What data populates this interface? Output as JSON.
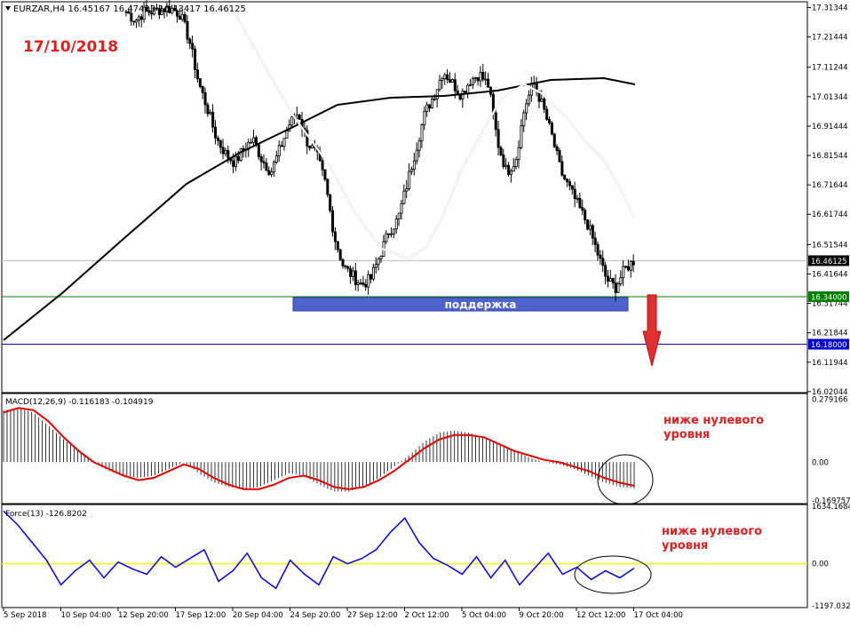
{
  "window": {
    "instrument_info": "EURZAR,H4  16.45167 16.47423 16.43417 16.46125",
    "date_stamp": "17/10/2018"
  },
  "colors": {
    "candles": "#000000",
    "ma_slow": "#000000",
    "ma_fast": "#ffffff",
    "support_line": "#008000",
    "target_line": "#0000cd",
    "support_zone": "#4f63cf",
    "arrow": "#e03030",
    "macd_signal": "#e00000",
    "force_line": "#0000e6",
    "force_zero": "#ffff00",
    "annotation_text": "#e02020",
    "ellipse": "#000000"
  },
  "chart_data": [
    {
      "type": "candlestick",
      "panel": "price",
      "title": "EURZAR,H4",
      "ohlc_header": {
        "open": 16.45167,
        "high": 16.47423,
        "low": 16.43417,
        "close": 16.46125
      },
      "y_ticks": [
        "17.31344",
        "17.21444",
        "17.11244",
        "17.01344",
        "16.91444",
        "16.81544",
        "16.71644",
        "16.61744",
        "16.51544",
        "16.41644",
        "16.31744",
        "16.21844",
        "16.11944",
        "16.02044"
      ],
      "ylim": [
        16.02,
        17.33
      ],
      "current_price": "16.46125",
      "support_level": "16.34000",
      "target_level": "16.18000",
      "support_zone_label": "поддержка",
      "approx_close_path": [
        17.3,
        17.27,
        17.3,
        17.3,
        17.31,
        17.31,
        17.29,
        17.2,
        17.06,
        16.97,
        16.87,
        16.82,
        16.79,
        16.84,
        16.87,
        16.8,
        16.76,
        16.84,
        16.92,
        16.96,
        16.86,
        16.82,
        16.72,
        16.54,
        16.44,
        16.41,
        16.38,
        16.4,
        16.48,
        16.56,
        16.6,
        16.72,
        16.84,
        16.96,
        17.02,
        17.1,
        17.06,
        17.02,
        17.07,
        17.09,
        17.05,
        16.86,
        16.76,
        16.8,
        16.98,
        17.06,
        16.98,
        16.88,
        16.76,
        16.7,
        16.64,
        16.58,
        16.49,
        16.4,
        16.37,
        16.43,
        16.46
      ]
    },
    {
      "type": "bar",
      "panel": "macd",
      "label": "MACD(12,26,9) -0.116183 -0.104919",
      "y_ticks": [
        "0.279166",
        "0.00",
        "-0.169757"
      ],
      "ylim": [
        -0.18,
        0.3
      ],
      "approx_histogram": [
        0.23,
        0.24,
        0.22,
        0.16,
        0.1,
        0.05,
        0.0,
        -0.04,
        -0.06,
        -0.07,
        -0.06,
        -0.03,
        0.0,
        -0.05,
        -0.09,
        -0.11,
        -0.12,
        -0.11,
        -0.08,
        -0.05,
        -0.06,
        -0.1,
        -0.13,
        -0.13,
        -0.11,
        -0.07,
        -0.02,
        0.03,
        0.09,
        0.13,
        0.14,
        0.13,
        0.11,
        0.08,
        0.05,
        0.02,
        0.0,
        -0.01,
        -0.03,
        -0.06,
        -0.09,
        -0.11,
        -0.116
      ],
      "approx_signal": [
        0.22,
        0.24,
        0.23,
        0.18,
        0.11,
        0.05,
        0.0,
        -0.03,
        -0.06,
        -0.08,
        -0.07,
        -0.04,
        -0.01,
        -0.03,
        -0.07,
        -0.1,
        -0.12,
        -0.12,
        -0.1,
        -0.07,
        -0.06,
        -0.08,
        -0.11,
        -0.12,
        -0.11,
        -0.08,
        -0.04,
        0.01,
        0.06,
        0.1,
        0.12,
        0.12,
        0.11,
        0.08,
        0.05,
        0.03,
        0.01,
        0.0,
        -0.02,
        -0.04,
        -0.07,
        -0.09,
        -0.105
      ]
    },
    {
      "type": "line",
      "panel": "force",
      "label": "Force(13) -126.8202",
      "y_ticks": [
        "1634.1684",
        "0.00",
        "-1197.0328"
      ],
      "ylim": [
        -1197,
        1634
      ],
      "approx_values": [
        1500,
        1100,
        600,
        100,
        -600,
        -200,
        100,
        -400,
        50,
        -150,
        -300,
        200,
        -100,
        150,
        400,
        -500,
        -200,
        300,
        -400,
        -700,
        100,
        -300,
        -600,
        200,
        0,
        150,
        400,
        900,
        1300,
        600,
        150,
        -50,
        -300,
        200,
        -400,
        100,
        -600,
        -150,
        300,
        -300,
        -100,
        -450,
        -200,
        -400,
        -127
      ]
    }
  ],
  "x_axis": {
    "labels": [
      "5 Sep 2018",
      "10 Sep 04:00",
      "12 Sep 20:00",
      "17 Sep 12:00",
      "20 Sep 04:00",
      "24 Sep 20:00",
      "27 Sep 12:00",
      "2 Oct 12:00",
      "5 Oct 04:00",
      "9 Oct 20:00",
      "12 Oct 12:00",
      "17 Oct 04:00"
    ]
  },
  "annotations": {
    "macd_note": "ниже нулевого\nуровня",
    "force_note": "ниже нулевого\nуровня"
  }
}
